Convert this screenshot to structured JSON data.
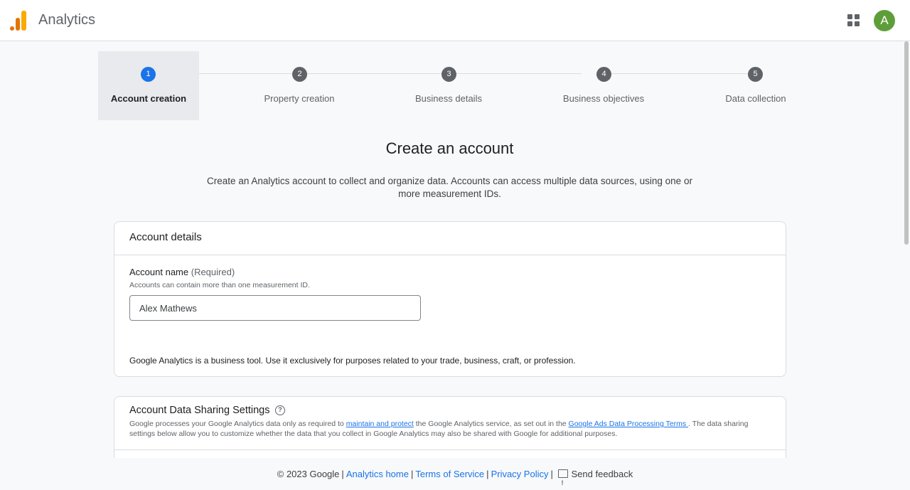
{
  "header": {
    "app_title": "Analytics",
    "apps_icon": "apps-grid-icon",
    "avatar_initial": "A",
    "avatar_color": "#5e9e3a",
    "logo_colors": [
      "#e37400",
      "#f9ab00"
    ]
  },
  "stepper": {
    "steps": [
      {
        "number": "1",
        "label": "Account creation",
        "active": true
      },
      {
        "number": "2",
        "label": "Property creation",
        "active": false
      },
      {
        "number": "3",
        "label": "Business details",
        "active": false
      },
      {
        "number": "4",
        "label": "Business objectives",
        "active": false
      },
      {
        "number": "5",
        "label": "Data collection",
        "active": false
      }
    ],
    "active_color": "#1a73e8"
  },
  "main": {
    "title": "Create an account",
    "description": "Create an Analytics account to collect and organize data. Accounts can access multiple data sources, using one or more measurement IDs."
  },
  "account_details": {
    "header": "Account details",
    "field_label": "Account name",
    "field_required": "(Required)",
    "field_hint": "Accounts can contain more than one measurement ID.",
    "field_value": "Alex Mathews",
    "business_note": "Google Analytics is a business tool. Use it exclusively for purposes related to your trade, business, craft, or profession."
  },
  "data_sharing": {
    "title": "Account Data Sharing Settings",
    "help_icon": "help-circle-icon",
    "desc_part1": "Google processes your Google Analytics data only as required to ",
    "link1": "maintain and protect",
    "desc_part2": " the Google Analytics service, as set out in the ",
    "link2": "Google Ads Data Processing Terms ",
    "desc_part3": ". The data sharing settings below allow you to customize whether the data that you collect in Google Analytics may also be shared with Google for additional purposes."
  },
  "footer": {
    "copyright": "© 2023 Google",
    "analytics_home": "Analytics home",
    "terms": "Terms of Service",
    "privacy": "Privacy Policy",
    "feedback": "Send feedback",
    "feedback_icon": "feedback-icon"
  }
}
